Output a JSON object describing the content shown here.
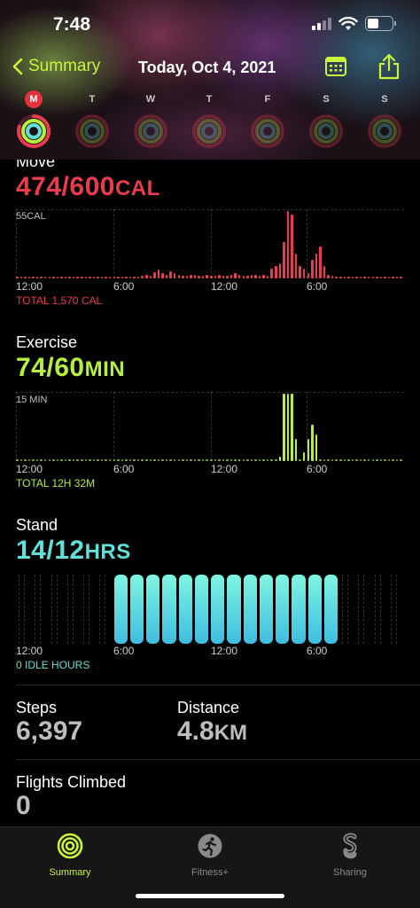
{
  "status_bar": {
    "time": "7:48"
  },
  "nav": {
    "back_label": "Summary",
    "title": "Today, Oct 4, 2021"
  },
  "week": [
    {
      "letter": "M",
      "today": true
    },
    {
      "letter": "T",
      "today": false
    },
    {
      "letter": "W",
      "today": false
    },
    {
      "letter": "T",
      "today": false
    },
    {
      "letter": "F",
      "today": false
    },
    {
      "letter": "S",
      "today": false
    },
    {
      "letter": "S",
      "today": false
    }
  ],
  "colors": {
    "move": "#ec3a4e",
    "exercise": "#b5f03a",
    "stand": "#5fe0db",
    "accent": "#c8f53a"
  },
  "move": {
    "label": "Move",
    "value": "474/600",
    "unit": "CAL",
    "chart_top": "55CAL",
    "total": "TOTAL 1,570 CAL"
  },
  "exercise": {
    "label": "Exercise",
    "value": "74/60",
    "unit": "MIN",
    "chart_top": "15 MIN",
    "total": "TOTAL 12H 32M"
  },
  "stand": {
    "label": "Stand",
    "value": "14/12",
    "unit": "HRS",
    "total": "0 IDLE HOURS"
  },
  "axis_ticks": [
    "12:00",
    "6:00",
    "12:00",
    "6:00"
  ],
  "steps": {
    "label": "Steps",
    "value": "6,397"
  },
  "distance": {
    "label": "Distance",
    "value": "4.8",
    "unit": "KM"
  },
  "flights": {
    "label": "Flights Climbed",
    "value": "0"
  },
  "tabs": [
    {
      "label": "Summary",
      "icon": "activity-rings-icon",
      "active": true
    },
    {
      "label": "Fitness+",
      "icon": "running-figure-icon",
      "active": false
    },
    {
      "label": "Sharing",
      "icon": "sharing-icon",
      "active": false
    }
  ],
  "chart_data": [
    {
      "type": "bar",
      "title": "Move",
      "ylabel": "55CAL",
      "x_ticks": [
        "12:00",
        "6:00",
        "12:00",
        "6:00"
      ],
      "values": [
        1,
        1,
        1,
        1,
        1,
        1,
        1,
        1,
        1,
        1,
        1,
        1,
        1,
        1,
        1,
        1,
        1,
        1,
        1,
        1,
        1,
        1,
        1,
        1,
        1,
        1,
        1,
        1,
        1,
        1,
        1,
        2,
        3,
        2,
        5,
        7,
        4,
        3,
        6,
        4,
        3,
        2,
        2,
        3,
        3,
        2,
        2,
        3,
        2,
        2,
        3,
        2,
        2,
        3,
        4,
        3,
        2,
        2,
        3,
        3,
        2,
        3,
        2,
        8,
        10,
        12,
        30,
        55,
        52,
        20,
        10,
        8,
        4,
        15,
        20,
        26,
        10,
        3,
        2,
        1,
        1,
        1,
        1,
        1,
        1,
        1,
        1,
        1,
        1,
        1,
        1,
        1,
        1,
        1,
        1,
        1
      ],
      "ylim": [
        0,
        55
      ]
    },
    {
      "type": "bar",
      "title": "Exercise",
      "ylabel": "15 MIN",
      "x_ticks": [
        "12:00",
        "6:00",
        "12:00",
        "6:00"
      ],
      "values": [
        0,
        0,
        0,
        0,
        0,
        0,
        0,
        0,
        0,
        0,
        0,
        0,
        0,
        0,
        0,
        0,
        0,
        0,
        0,
        0,
        0,
        0,
        0,
        0,
        0,
        0,
        0,
        0,
        0,
        0,
        0,
        0,
        0,
        0,
        0,
        0,
        0,
        0,
        0,
        0,
        0,
        0,
        0,
        0,
        0,
        0,
        0,
        0,
        0,
        0,
        0,
        0,
        0,
        0,
        0,
        0.4,
        0,
        0,
        0,
        0,
        0,
        0,
        0,
        0,
        0,
        1,
        15,
        15,
        15,
        5,
        0,
        2,
        5,
        8,
        6,
        0,
        0,
        0,
        0,
        0,
        0,
        0,
        0,
        0,
        0,
        0,
        0,
        0,
        0,
        0,
        0,
        0,
        0,
        0,
        0,
        0
      ],
      "ylim": [
        0,
        15
      ]
    },
    {
      "type": "bar",
      "title": "Stand",
      "x_ticks": [
        "12:00",
        "6:00",
        "12:00",
        "6:00"
      ],
      "values": [
        0,
        0,
        0,
        0,
        0,
        0,
        1,
        1,
        1,
        1,
        1,
        1,
        1,
        1,
        1,
        1,
        1,
        1,
        1,
        1,
        0,
        0,
        0,
        0
      ],
      "ylim": [
        0,
        1
      ]
    }
  ]
}
